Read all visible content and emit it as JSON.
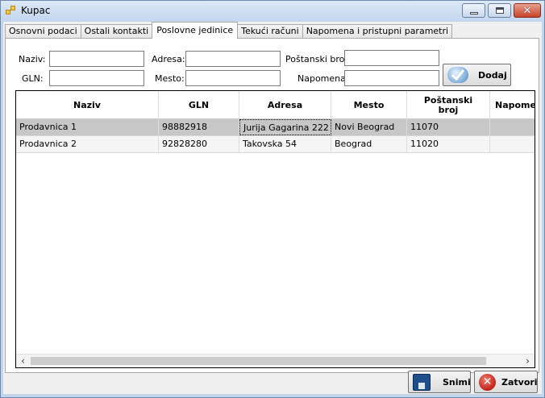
{
  "window": {
    "title": "Kupac",
    "icon": "app-window-icon"
  },
  "tabs": [
    {
      "label": "Osnovni podaci"
    },
    {
      "label": "Ostali kontakti"
    },
    {
      "label": "Poslovne jedinice"
    },
    {
      "label": "Tekući računi"
    },
    {
      "label": "Napomena i pristupni parametri"
    }
  ],
  "active_tab": "Poslovne jedinice",
  "form": {
    "naziv_label": "Naziv:",
    "gln_label": "GLN:",
    "adresa_label": "Adresa:",
    "mesto_label": "Mesto:",
    "postanski_label": "Poštanski broj:",
    "napomena_label": "Napomena:",
    "naziv_value": "",
    "gln_value": "",
    "adresa_value": "",
    "mesto_value": "",
    "postanski_value": "",
    "napomena_value": "",
    "add_button": "Dodaj"
  },
  "grid": {
    "headers": [
      "Naziv",
      "GLN",
      "Adresa",
      "Mesto",
      "Poštanski\nbroj",
      "Napomena"
    ],
    "rows": [
      {
        "naziv": "Prodavnica 1",
        "gln": "98882918",
        "adresa": "Jurija Gagarina 222",
        "mesto": "Novi Beograd",
        "postanski": "11070",
        "napomena": ""
      },
      {
        "naziv": "Prodavnica 2",
        "gln": "92828280",
        "adresa": "Takovska 54",
        "mesto": "Beograd",
        "postanski": "11020",
        "napomena": ""
      }
    ]
  },
  "buttons": {
    "save": "Snimi",
    "close": "Zatvori"
  },
  "colors": {
    "selected_row": "#c7c7c7",
    "title_bar": "#c3d6ee",
    "close_button": "#c8432a"
  }
}
